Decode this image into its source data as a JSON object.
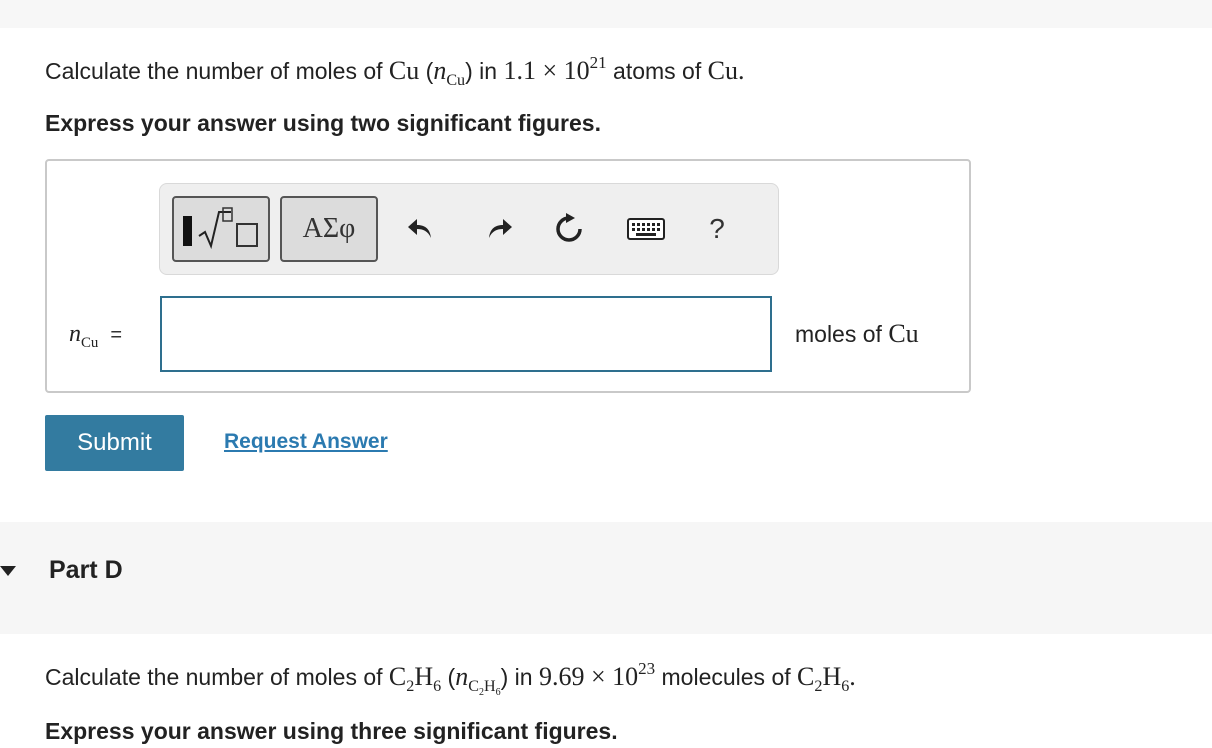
{
  "partC": {
    "question": {
      "prefix": "Calculate the number of moles of ",
      "element": "Cu",
      "open_paren": " (",
      "var_n": "n",
      "var_sub": "Cu",
      "close_in": ") in ",
      "mantissa": "1.1 × 10",
      "exponent": "21",
      "mid": " atoms of ",
      "element2": "Cu",
      "end": "."
    },
    "instruction": "Express your answer using two significant figures.",
    "toolbar": {
      "templates_icon": "templates-sqrt-icon",
      "greek_label": "ΑΣφ",
      "undo_icon": "undo-icon",
      "redo_icon": "redo-icon",
      "reset_icon": "reset-icon",
      "keyboard_icon": "keyboard-icon",
      "help_label": "?"
    },
    "answer_label": {
      "n": "n",
      "sub": "Cu",
      "eq": "="
    },
    "answer_value": "",
    "units": {
      "text": "moles of ",
      "element": "Cu"
    },
    "submit_label": "Submit",
    "request_label": "Request Answer"
  },
  "partD": {
    "title": "Part D",
    "question": {
      "prefix": "Calculate the number of moles of ",
      "formula_C": "C",
      "formula_C_sub": "2",
      "formula_H": "H",
      "formula_H_sub": "6",
      "open_paren": " (",
      "var_n": "n",
      "var_sub_C": "C",
      "var_sub_C_sub": "2",
      "var_sub_H": "H",
      "var_sub_H_sub": "6",
      "close_in": ") in ",
      "mantissa": "9.69 × 10",
      "exponent": "23",
      "mid": " molecules of ",
      "formula2_C": "C",
      "formula2_C_sub": "2",
      "formula2_H": "H",
      "formula2_H_sub": "6",
      "end": "."
    },
    "instruction": "Express your answer using three significant figures."
  },
  "colors": {
    "submit_bg": "#337ba0",
    "link": "#2b7ab0",
    "input_border": "#2e6f8e",
    "band_bg": "#f6f6f6"
  }
}
